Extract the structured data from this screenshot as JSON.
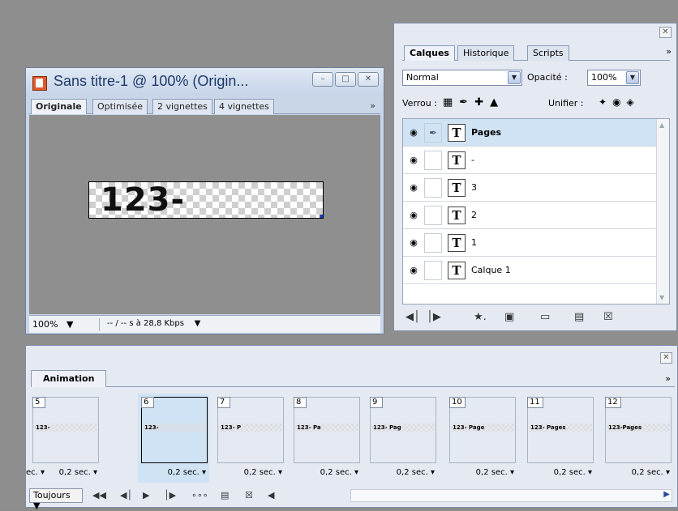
{
  "document_window": {
    "title": "Sans titre-1 @ 100% (Origin...",
    "tabs": [
      "Originale",
      "Optimisée",
      "2 vignettes",
      "4 vignettes"
    ],
    "tabs_more": "»",
    "canvas_text": "123-",
    "zoom": "100%",
    "status": "-- / -- s à 28,8 Kbps"
  },
  "layers_panel": {
    "tabs": [
      "Calques",
      "Historique",
      "Scripts"
    ],
    "tabs_more": "»",
    "blend_mode": "Normal",
    "opacity_label": "Opacité :",
    "opacity_value": "100%",
    "lock_label": "Verrou :",
    "unify_label": "Unifier :",
    "layers": [
      {
        "name": "Pages",
        "selected": true
      },
      {
        "name": "-",
        "selected": false
      },
      {
        "name": "3",
        "selected": false
      },
      {
        "name": "2",
        "selected": false
      },
      {
        "name": "1",
        "selected": false
      },
      {
        "name": "Calque 1",
        "selected": false
      }
    ],
    "text_layer_glyph": "T"
  },
  "animation_panel": {
    "tab": "Animation",
    "tabs_more": "»",
    "frames": [
      {
        "number": "5",
        "thumb": "123-",
        "delay": "0,2 sec."
      },
      {
        "number": "6",
        "thumb": "123-",
        "delay": "0,2 sec."
      },
      {
        "number": "7",
        "thumb": "123-      P",
        "delay": "0,2 sec."
      },
      {
        "number": "8",
        "thumb": "123-     Pa",
        "delay": "0,2 sec."
      },
      {
        "number": "9",
        "thumb": "123-   Pag",
        "delay": "0,2 sec."
      },
      {
        "number": "10",
        "thumb": "123-  Page",
        "delay": "0,2 sec."
      },
      {
        "number": "11",
        "thumb": "123- Pages",
        "delay": "0,2 sec."
      },
      {
        "number": "12",
        "thumb": "123-Pages",
        "delay": "0,2 sec."
      }
    ],
    "partial_delay_left": "ec.",
    "loop_option": "Toujours"
  },
  "colors": {
    "selection": "#cfe3f4",
    "panel_bg": "#e4e9f2",
    "workspace": "#8e8e8e"
  }
}
